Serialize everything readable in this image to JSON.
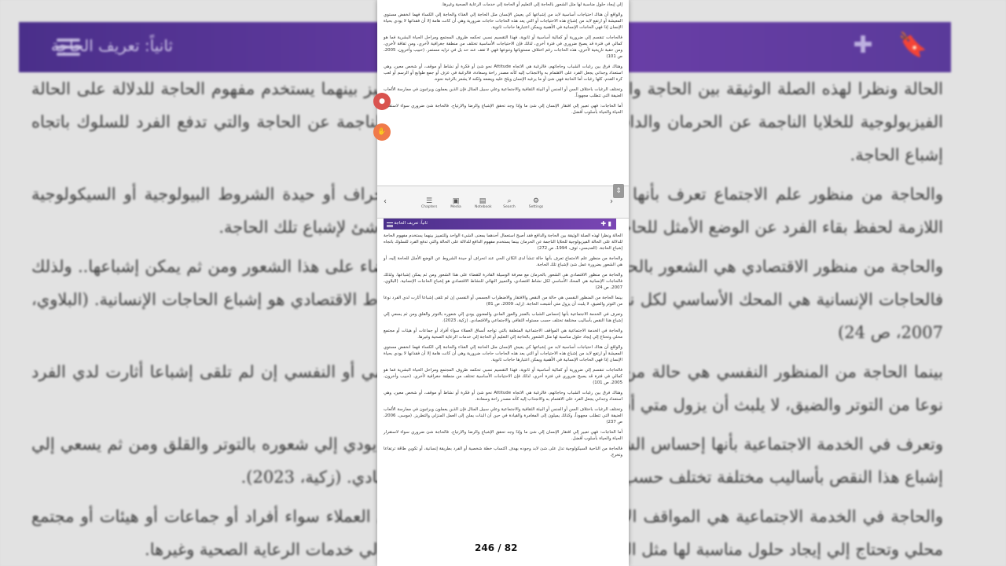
{
  "background": {
    "title": "ثانياً: تعريف الحاجة",
    "paragraphs": [
      "الحالة ونظرا لهذه الصلة الوثيقة بين الحاجة والدافع فقد أصبح الشيء الواحد وللتمييز بينهما يستخدم مفهوم الحاجة للدلالة على الحالة الفيزيولوجية للخلايا الناجمة عن الحرمان والدافع للدلالة على الحالة السيكولوجية الناجمة عن الحاجة والتي تدفع الفرد للسلوك باتجاه إشباع الحاجة.",
      "والحاجة من منظور علم الاجتماع تعرف بأنها حالة تنشأ لدى الكائن الحي عند انحراف أو حيدة الشروط البيولوجية أو السيكولوجية اللازمة لحفظ بقاء الفرد عن الوضع الأمثل للحاجة إليه، أو هي الشعور بضرورة عمل شئ لإشباع تلك الحاجة.",
      "والحاجة من منظور الاقتصادي هي الشعور بالحرمان مع معرفة الوسيلة القادرة للقضاء على هذا الشعور ومن ثم يمكن إشباعها.. ولذلك فالحاجات الإنسانية هي المحك الأساسي لكل نشاط اقتصادي، والتمييز النهائي للنشاط الاقتصادي هو إشباع الحاجات الإنسانية. (البلاوي، 2007، ص 24)",
      "بينما الحاجة من المنظور النفسي هي حالة من النقص والافتقار والاضطراب الجسمي أو النفسي إن لم تلقى إشباعا أثارت لدي الفرد نوعا من التوتر والضيق، لا يلبث أن يزول متي أشبعت الحاجة. (زايد، 2009، ص 81)",
      "وتعرف في الخدمة الاجتماعية بأنها إحساس الشباب بالعجز والعوز المادي والمعنوي يودي إلي شعوره بالتوتر والقلق ومن ثم يسعي إلي إشباع هذا النقص بأساليب مختلفة تختلف حسب مستواه الثقافي والاجتماعي والاقتصادي. (زكية، 2023).",
      "والحاجة في الخدمة الاجتماعية هي المواقف الاجتماعية المتعلقة بالتي تواجه أنساق العملاء سواء أفراد أو جماعات أو هيئات أو مجتمع محلي وتحتاج إلي إيجاد حلول مناسبة لها مثل الشعور بالحاجة إلي التعليم أو الحاجة إلي خدمات الرعاية الصحية وغيرها."
    ]
  },
  "phone": {
    "title_bar": "ثانياً: تعريف الحاجة",
    "top_paragraphs": [
      "إلي إيجاد حلول مناسبة لها مثل الشعور بالحاجة إلي التعليم أو الحاجة إلي خدمات الرعاية الصحية وغيرها.",
      "والواقع أن هناك احتياجات أساسية لابد من إشباعها كي يعيش الإنسان مثل الحاجة إلي الغذاء والحاجة إلي الكساء فهما انخفض مستوي المعيشة أو ارتفع لابد من إشباع هذه الاحتياجات أو التي يعد هذه الحاجات حاجات ضرورية وهي أن كانت هامة إلا أن فقدانها لا يودي بحياة الإنسان إذا فهي الحاجات الإنسانية في الأهمية ويمكن اعتبارها حاجات ثانوية.",
      "فالحاجات تنقسم إلي ضرورية أو كمالية أساسية أو ثانوية، فهذا التقسيم نسبي تحكمه ظروف المجتمع ومراحل الحياة البشرية فما هو كمالي في فترة قد يصبح ضروري في فترة أخري، لذلك فإن الاحتياجات الأساسية تختلف من منطقة جغرافية لأخري، ومن ثقافة لأخري، ومن حقبة تاريخية لأخري، هذه الحاجات رغم اختلاف مستوياتها وتنوعها فهي لا تقف عند حد بل في تزايد مستمر. (حبيب وأخرون، 2005، ص 101)",
      "وهناك فرق بين رغبات الشباب وحاجاتهم، فالرغبة هي الاتجاه Attitude نحو شئ أو فكرة أو نشاط أو موقف، أو شخص معين، وهي استعداد وجداني يجعل الفرد على الاهتمام به والانجذاب إليه كأنه مصدر راحة وسعادة، فالرغبة في عزف أو جمع طوابع أو الرسم أو لعب كرة القدم، كلها رغبات أما الحاجة فهي شئ أو ما يرغبه الإنسان ويلح عليه ويضعه ولكنه لا يشعر بالرغبة نحوه.",
      "وتختلف الرغبات باختلاف السن أو الجنس أو البيئة الثقافية والاجتماعية وعلي سبيل المثال فإن الذين يعملون ويرغبون في ممارسة الألعاب العنيفة التي تتطلب مجهوداً.",
      "أما الحاجات: فهي تعبير إلي افتقار الإنسان إلي شئ ما وإذا وجد تحقق الإشباع والرضا والارتياح. فالحاجة شئ ضروري سواء لاستقرار الحياة والحياة بأسلوب أفضل."
    ],
    "bottom_paragraphs": [
      "الحالة ونظرا لهذه الصلة الوثيقة بين الحاجة والدافع فقد أصبح استعمال أحدهما بمعنى الشيء الواحد وللتمييز بينهما يستخدم مفهوم الحاجة للدلالة على الحالة الفيزيولوجية للخلايا الناجمة عن الحرمان بينما يستخدم مفهوم الدافع للدلالة على الحالة والتي تدفع الفرد للسلوك باتجاه إشباع الحاجة. (العديسي، ثوف، 1994، ص 272)",
      "والحاجة من منظور علم الاجتماع تعرف بأنها حالة تنشأ لدى الكائن الحي عند انحراف أو حيدة الشروط عن الوضع الأمثل للحاجة إليه، أو هي الشعور بضرورة عمل شئ لإشباع تلك الحاجة.",
      "والحاجة من منظور الاقتصادي هي الشعور بالحرمان مع معرفة الوسيلة القادرة للقضاء على هذا الشعور ومن ثم يمكن إشباعها. ولذلك فالحاجات الإنسانية هي المحك الأساسي لكل نشاط اقتصادي، والتمييز النهائي للنشاط الاقتصادي هو إشباع الحاجات الإنسانية. (البلاوي، 2007، ص 24)",
      "بينما الحاجة من المنظور النفسي هي حالة من النقص والافتقار والاضطراب الجسمي أو النفسي إن لم تلقى إشباعا أثارت لدي الفرد نوعا من التوتر والضيق، لا يلبث أن يزول متي أشبعت الحاجة. (زايد، 2009، ص 81)",
      "وتعرف في الخدمة الاجتماعية بأنها إحساس الشباب بالعجز والعوز المادي والمعنوي يودي إلي شعوره بالتوتر والقلق ومن ثم يسعي إلي إشباع هذا النقص بأساليب مختلفة تختلف حسب مستواه الثقافي والاجتماعي والاقتصادي. (زكية، 2023).",
      "والحاجة في الخدمة الاجتماعية هي المواقف الاجتماعية المتعلقة بالتي تواجه أنساق العملاء سواء أفراد أو جماعات أو هيئات أو مجتمع محلي وتحتاج إلي إيجاد حلول مناسبة لها مثل الشعور بالحاجة إلي التعليم أو الحاجة إلي خدمات الرعاية الصحية وغيرها.",
      "والواقع أن هناك احتياجات أساسية لابد من إشباعها كي يعيش الإنسان مثل الحاجة إلي الغذاء والحاجة إلي الكساء فهما انخفض مستوي المعيشة أو ارتفع لابد من إشباع هذه الاحتياجات أو التي يعد هذه الحاجات حاجات ضرورية وهي أن كانت هامة إلا أن فقدانها لا يودي بحياة الإنسان إذا فهي الحاجات الإنسانية في الأهمية ويمكن اعتبارها حاجات ثانوية.",
      "فالحاجات تنقسم إلي ضرورية أو كمالية أساسية أو ثانوية، فهذا التقسيم نسبي تحكمه ظروف المجتمع ومراحل الحياة البشرية فما هو كمالي في فترة قد يصبح ضروري في فترة أخري، لذلك فإن الاحتياجات الأساسية تختلف من منطقة جغرافية لأخري. (حبيب وأخرون، 2005، ص 101)",
      "وهناك فرق بين رغبات الشباب وحاجاتهم، فالرغبة هي الاتجاه Attitude نحو شئ أو فكرة أو نشاط أو موقف، أو شخص معين، وهي استعداد وجداني يجعل الفرد على الاهتمام به والانجذاب إليه كأنه مصدر راحة وسعادة.",
      "وتختلف الرغبات باختلاف السن أو الجنس أو البيئة الثقافية والاجتماعية وعلي سبيل المثال فإن الذين يعملون ويرغبون في ممارسة الألعاب العنيفة التي تتطلب مجهوداً، وكذلك يميلون إلى المغامرة والقيادة في حين أن البنات يملن إلى العمل المنزلي والتطريز. (موسى، 2006، ص 237)",
      "أما الحاجات: فهي تعبير إلي افتقار الإنسان إلي شئ ما وإذا وجد تحقق الإشباع والرضا والارتياح. فالحاجة شئ ضروري سواء لاستقرار الحياة والحياة بأسلوب أفضل.",
      "فالحاجة من الناحية السيكولوجية تدل على شئ لابد وجوده بهدف اكتساب خطة شخصية أو الفرد بطريقة إنسانية، أو تكوين طاقة ترتفاعا وتخرج.",
      "وعلي الأخصائي الذي يعمل مع جماعات الشباب أن يتيح لهم فرص للتعبير عن احتياجاتهم بوسائل متعددة."
    ],
    "toolbar": {
      "prev": "‹",
      "next": "›",
      "chapters": "Chapters",
      "media": "Media",
      "notebook": "Notebook",
      "search": "Search",
      "settings": "Settings"
    },
    "page_counter": "246 / 82"
  }
}
